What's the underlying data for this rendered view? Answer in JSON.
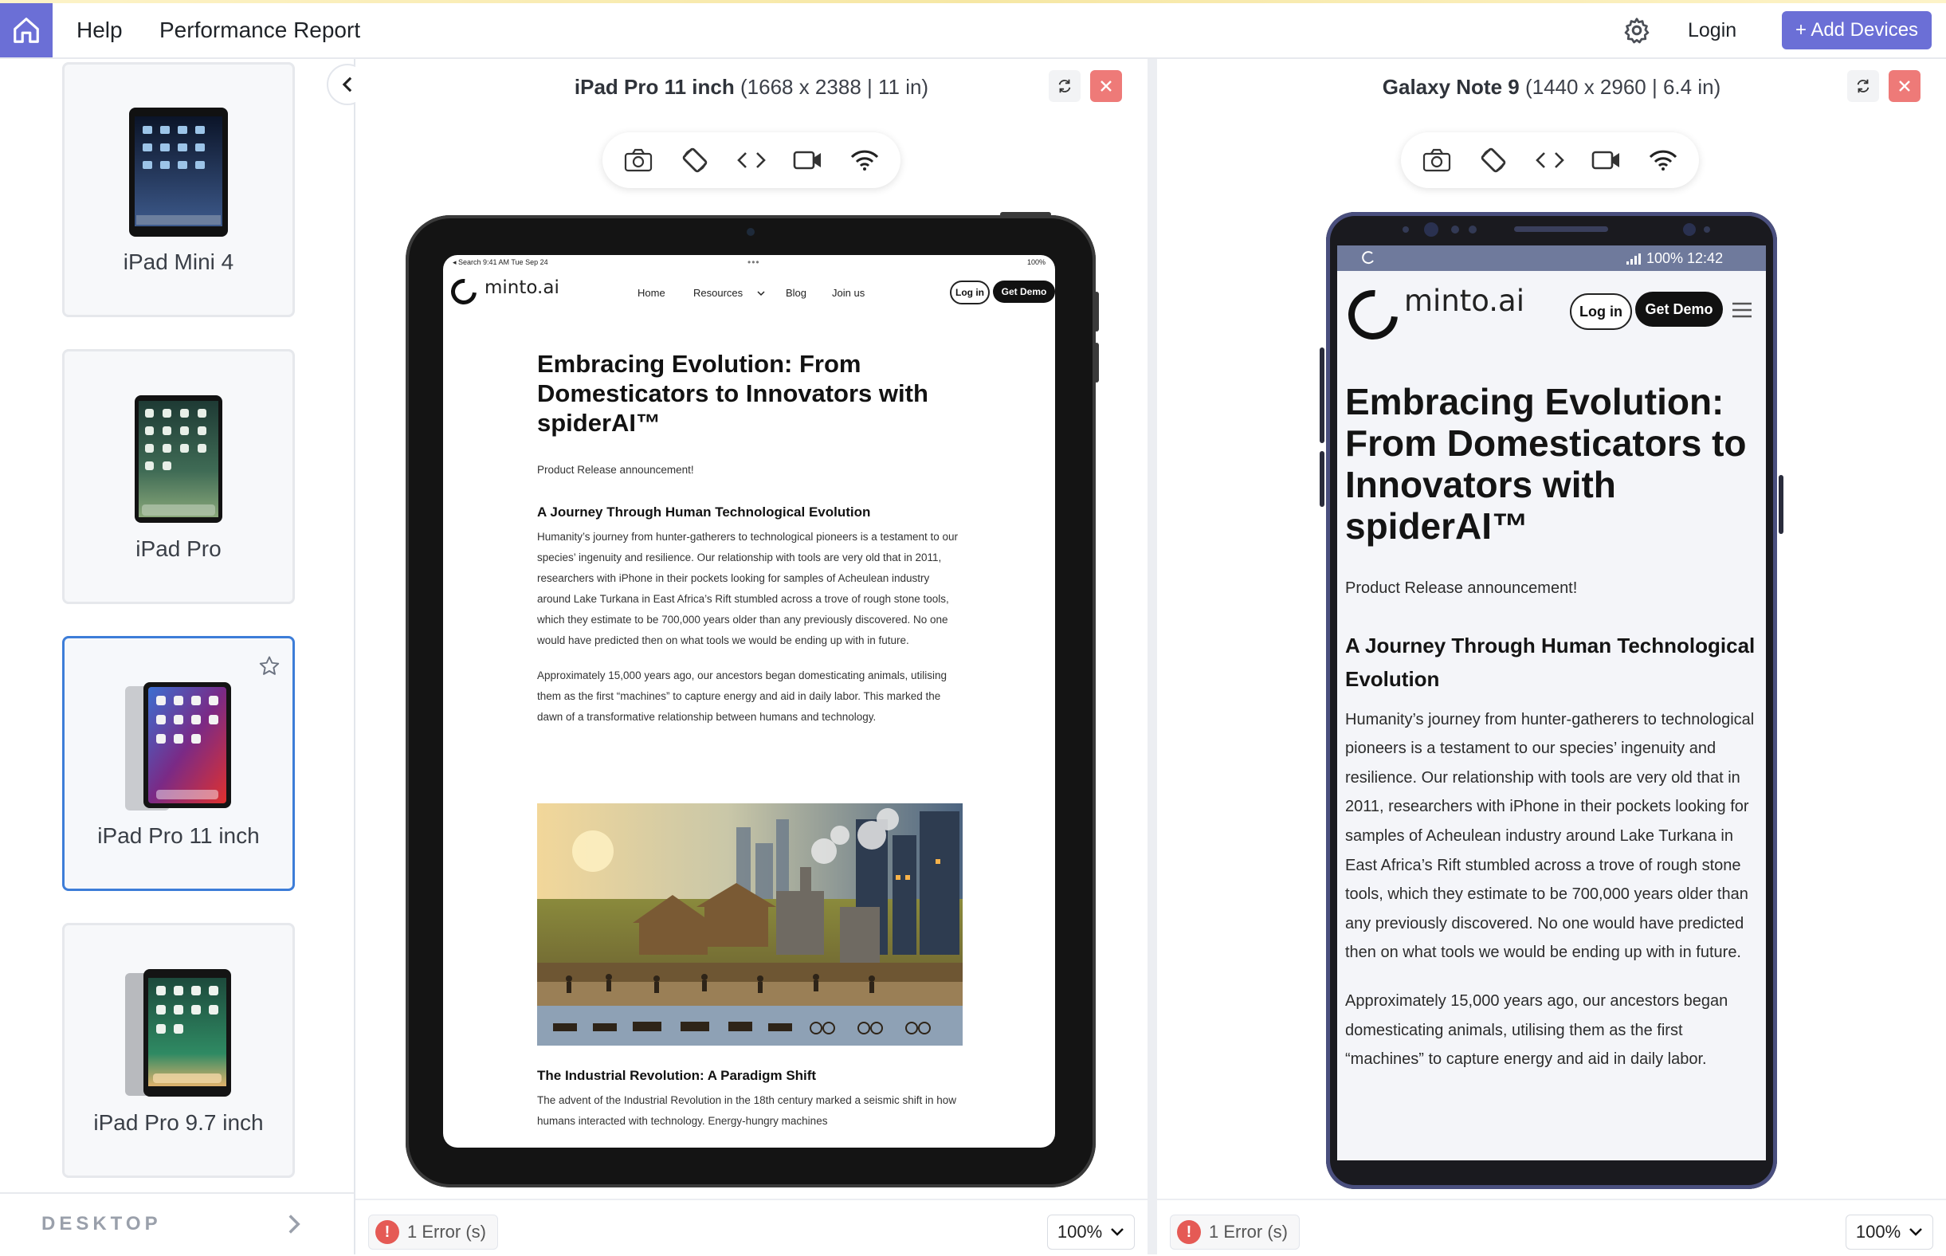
{
  "topbar": {
    "help": "Help",
    "performance": "Performance Report",
    "login": "Login",
    "add_devices": "+ Add Devices",
    "home_icon": "home-icon",
    "settings_icon": "gear-icon"
  },
  "sidebar": {
    "devices": [
      {
        "name": "iPad Mini 4"
      },
      {
        "name": "iPad Pro"
      },
      {
        "name": "iPad Pro 11 inch",
        "selected": true
      },
      {
        "name": "iPad Pro 9.7 inch"
      }
    ],
    "section": "DESKTOP"
  },
  "pane1": {
    "device": "iPad Pro 11 inch",
    "specs": " (1668 x 2388 | 11 in)",
    "errors": "1 Error (s)",
    "zoom": "100%",
    "tools": [
      "camera-icon",
      "rotate-icon",
      "code-icon",
      "video-icon",
      "wifi-icon"
    ]
  },
  "pane2": {
    "device": "Galaxy Note 9",
    "specs": " (1440 x 2960 | 6.4 in)",
    "errors": "1 Error (s)",
    "zoom": "100%"
  },
  "site": {
    "ios_status_left": "◂ Search   9:41 AM   Tue Sep 24",
    "ios_status_dots": "•••",
    "ios_status_right": "100%",
    "logo": "minto.ai",
    "nav": [
      "Home",
      "Resources",
      "Blog",
      "Join us"
    ],
    "login": "Log in",
    "demo": "Get Demo",
    "title": "Embracing Evolution: From Domesticators to Innovators with spiderAI™",
    "announce": "Product Release announcement!",
    "h2": "A Journey Through Human Technological Evolution",
    "p1": "Humanity’s journey from hunter-gatherers to technological pioneers is a testament to our species’ ingenuity and resilience. Our relationship with tools are very old that in 2011, researchers with iPhone in their pockets looking for samples of Acheulean industry around Lake Turkana in East Africa’s Rift stumbled across a trove of rough stone tools, which they estimate to be 700,000 years older than any previously discovered. No one would have predicted then on what tools we would be ending up with in future.",
    "p2": "Approximately 15,000 years ago, our ancestors began domesticating animals, utilising them as the first “machines” to capture energy and aid in daily labor. This marked the dawn of a transformative relationship between humans and technology.",
    "h3": "The Industrial Revolution: A Paradigm Shift",
    "p3": "The advent of the Industrial Revolution in the 18th century marked a seismic shift in how humans interacted with technology. Energy-hungry machines",
    "android_status": "100%  12:42",
    "android_p2": "Approximately 15,000 years ago, our ancestors began domesticating animals, utilising them as the first “machines” to capture energy and aid in daily labor."
  },
  "colors": {
    "accent": "#6b6fd6",
    "selected_border": "#3d7dd8",
    "close": "#ee7a78",
    "error": "#e55a55"
  }
}
